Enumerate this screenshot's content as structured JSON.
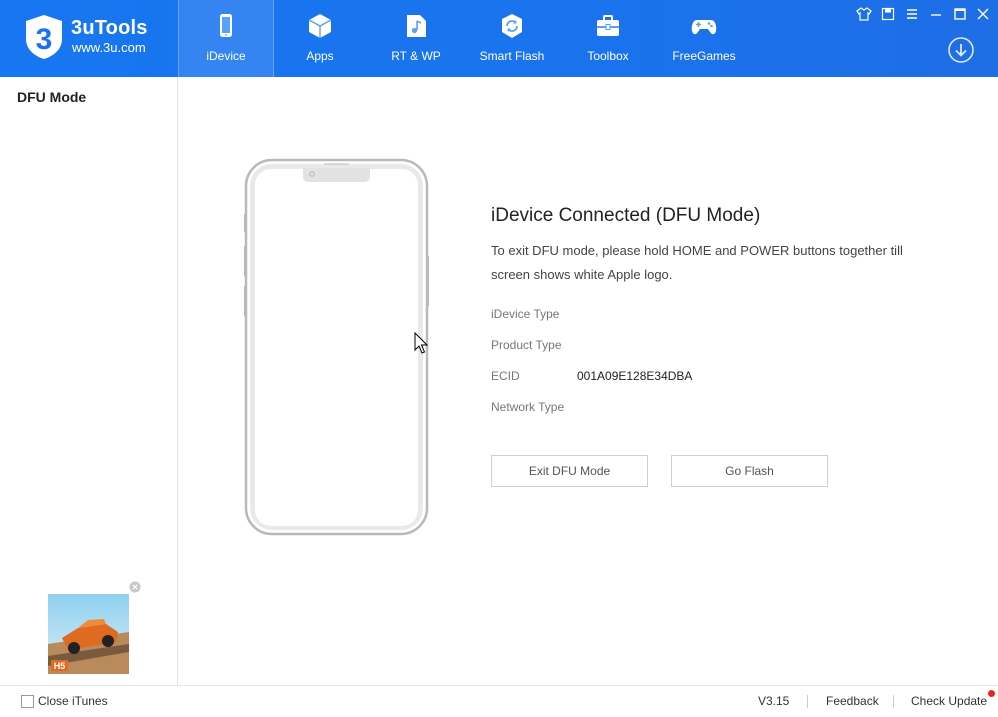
{
  "app": {
    "name": "3uTools",
    "url": "www.3u.com"
  },
  "nav": {
    "items": [
      {
        "label": "iDevice",
        "icon": "phone-icon",
        "active": true
      },
      {
        "label": "Apps",
        "icon": "cube-icon"
      },
      {
        "label": "RT & WP",
        "icon": "music-file-icon"
      },
      {
        "label": "Smart Flash",
        "icon": "refresh-icon"
      },
      {
        "label": "Toolbox",
        "icon": "toolbox-icon"
      },
      {
        "label": "FreeGames",
        "icon": "gamepad-icon"
      }
    ]
  },
  "window_controls": [
    "skin-icon",
    "save-icon",
    "menu-icon",
    "minimize-icon",
    "maximize-icon",
    "close-icon"
  ],
  "sidebar": {
    "title": "DFU Mode"
  },
  "main": {
    "title": "iDevice Connected (DFU Mode)",
    "description": "To exit DFU mode, please hold HOME and POWER buttons together till screen shows white Apple logo.",
    "info": [
      {
        "label": "iDevice Type",
        "value": ""
      },
      {
        "label": "Product Type",
        "value": ""
      },
      {
        "label": "ECID",
        "value": "001A09E128E34DBA"
      },
      {
        "label": "Network Type",
        "value": ""
      }
    ],
    "buttons": {
      "exit_dfu": "Exit DFU Mode",
      "go_flash": "Go Flash"
    }
  },
  "footer": {
    "close_itunes": "Close iTunes",
    "version": "V3.15",
    "feedback": "Feedback",
    "check_update": "Check Update"
  },
  "colors": {
    "header_blue": "#1a73ec",
    "update_dot": "#e8261b"
  }
}
